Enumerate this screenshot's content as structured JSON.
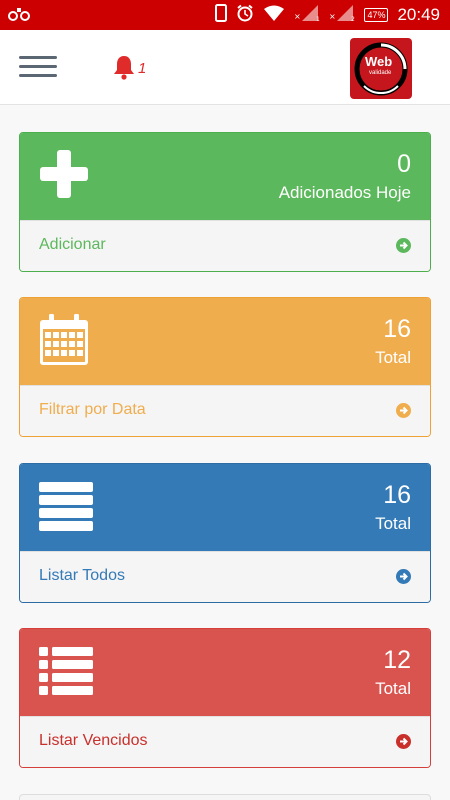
{
  "status_bar": {
    "battery": "47%",
    "time": "20:49"
  },
  "header": {
    "notification_count": "1",
    "logo_text": "Web",
    "logo_subtext": "validade"
  },
  "cards": [
    {
      "value": "0",
      "caption": "Adicionados Hoje",
      "action": "Adicionar",
      "icon": "plus-icon"
    },
    {
      "value": "16",
      "caption": "Total",
      "action": "Filtrar por Data",
      "icon": "calendar-icon"
    },
    {
      "value": "16",
      "caption": "Total",
      "action": "Listar Todos",
      "icon": "list-bars-icon"
    },
    {
      "value": "12",
      "caption": "Total",
      "action": "Listar Vencidos",
      "icon": "list-bullets-icon"
    }
  ],
  "colors": {
    "status_bar": "#cc0000",
    "green": "#5cb85c",
    "orange": "#f0ad4e",
    "blue": "#337ab7",
    "red": "#d9534f"
  }
}
